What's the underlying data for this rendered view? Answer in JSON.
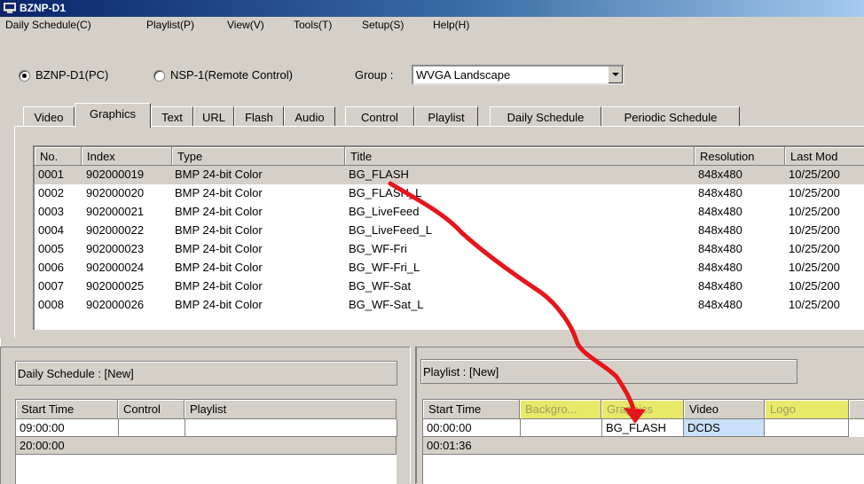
{
  "window": {
    "title": "BZNP-D1",
    "icon": "monitor-icon"
  },
  "menu": [
    "Daily Schedule(C)",
    "Playlist(P)",
    "View(V)",
    "Tools(T)",
    "Setup(S)",
    "Help(H)"
  ],
  "mode": {
    "option_pc": "BZNP-D1(PC)",
    "option_remote": "NSP-1(Remote Control)",
    "group_label": "Group :",
    "group_value": "WVGA Landscape"
  },
  "tabs": [
    "Video",
    "Graphics",
    "Text",
    "URL",
    "Flash",
    "Audio",
    "Control",
    "Playlist",
    "Daily Schedule",
    "Periodic Schedule"
  ],
  "active_tab": "Graphics",
  "graphics_table": {
    "columns": [
      "No.",
      "Index",
      "Type",
      "Title",
      "Resolution",
      "Last Mod"
    ],
    "rows": [
      [
        "0001",
        "902000019",
        "BMP 24-bit Color",
        "BG_FLASH",
        "848x480",
        "10/25/200"
      ],
      [
        "0002",
        "902000020",
        "BMP 24-bit Color",
        "BG_FLASH_L",
        "848x480",
        "10/25/200"
      ],
      [
        "0003",
        "902000021",
        "BMP 24-bit Color",
        "BG_LiveFeed",
        "848x480",
        "10/25/200"
      ],
      [
        "0004",
        "902000022",
        "BMP 24-bit Color",
        "BG_LiveFeed_L",
        "848x480",
        "10/25/200"
      ],
      [
        "0005",
        "902000023",
        "BMP 24-bit Color",
        "BG_WF-Fri",
        "848x480",
        "10/25/200"
      ],
      [
        "0006",
        "902000024",
        "BMP 24-bit Color",
        "BG_WF-Fri_L",
        "848x480",
        "10/25/200"
      ],
      [
        "0007",
        "902000025",
        "BMP 24-bit Color",
        "BG_WF-Sat",
        "848x480",
        "10/25/200"
      ],
      [
        "0008",
        "902000026",
        "BMP 24-bit Color",
        "BG_WF-Sat_L",
        "848x480",
        "10/25/200"
      ]
    ]
  },
  "daily_schedule": {
    "title": "Daily Schedule : [New]",
    "columns": [
      "Start Time",
      "Control",
      "Playlist"
    ],
    "rows": [
      [
        "09:00:00",
        "",
        ""
      ],
      [
        "20:00:00",
        "",
        ""
      ]
    ]
  },
  "playlist": {
    "title": "Playlist : [New]",
    "columns": [
      "Start Time",
      "Backgro...",
      "Graphics",
      "Video",
      "Logo"
    ],
    "rows": [
      [
        "00:00:00",
        "",
        "BG_FLASH",
        "DCDS",
        ""
      ],
      [
        "00:01:36",
        "",
        "",
        "",
        ""
      ]
    ]
  },
  "colors": {
    "highlight_header": "#e8e86a",
    "drag_arrow": "#e8141c",
    "selected_cell": "#c8e0f8"
  }
}
